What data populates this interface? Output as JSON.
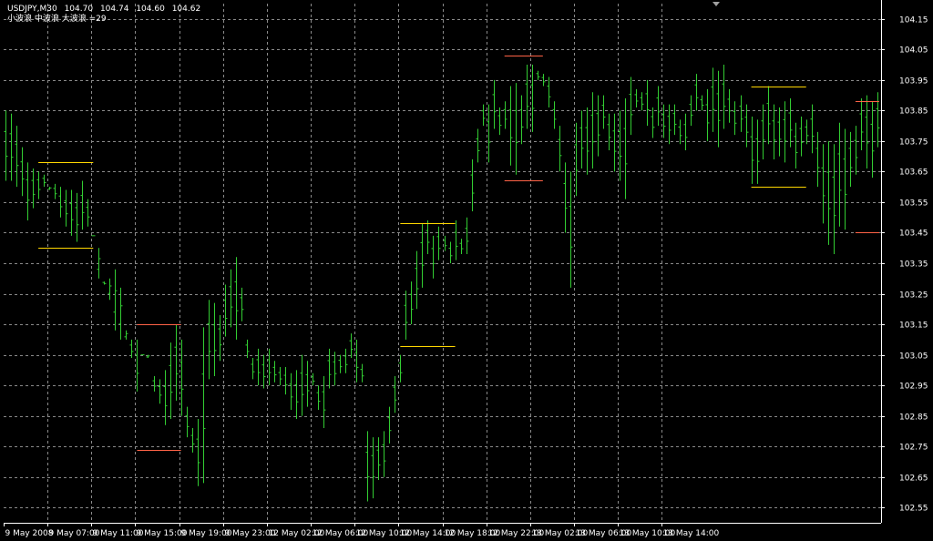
{
  "header": {
    "symbol": "USDJPY,M30",
    "open": "104.70",
    "high": "104.74",
    "low": "104.60",
    "close": "104.62",
    "indicator_label": "小波浪 中波浪 大波浪 =29"
  },
  "colors": {
    "background": "#000000",
    "grid": "#8a8a8a",
    "axis": "#ffffff",
    "bars": "#32cd32",
    "upper_level_a": "#ffd700",
    "upper_level_b": "#ff6347",
    "text": "#ffffff"
  },
  "chart_data": {
    "type": "ohlc",
    "title": "USDJPY,M30",
    "ylim": [
      102.5,
      104.2
    ],
    "y_ticks": [
      "104.15",
      "104.05",
      "103.95",
      "103.85",
      "103.75",
      "103.65",
      "103.55",
      "103.45",
      "103.35",
      "103.25",
      "103.15",
      "103.05",
      "102.95",
      "102.85",
      "102.75",
      "102.65",
      "102.55"
    ],
    "x_ticks": [
      "9 May 2008",
      "9 May 07:00",
      "9 May 11:00",
      "9 May 15:00",
      "9 May 19:00",
      "9 May 23:00",
      "12 May 02:00",
      "12 May 06:00",
      "12 May 10:00",
      "12 May 14:00",
      "12 May 18:00",
      "12 May 22:00",
      "13 May 02:00",
      "13 May 06:00",
      "13 May 10:00",
      "13 May 14:00"
    ],
    "grid": true,
    "bars_per_label": 8,
    "bar_count": 160,
    "lows": [
      103.62,
      103.62,
      103.6,
      103.57,
      103.49,
      103.53,
      103.56,
      103.6,
      103.6,
      103.56,
      103.5,
      103.47,
      103.44,
      103.42,
      103.46,
      103.47,
      103.44,
      103.4,
      103.28,
      103.3,
      103.33,
      103.27,
      103.13,
      103.04,
      102.93,
      103.05,
      103.05,
      102.93,
      102.89,
      102.82,
      102.84,
      102.9,
      102.85,
      102.78,
      102.73,
      102.62,
      102.63,
      102.97,
      102.98,
      103.03,
      103.11,
      103.14,
      103.1,
      103.16,
      103.04,
      102.97,
      102.95,
      102.94,
      102.95,
      102.96,
      102.95,
      102.92,
      102.87,
      102.84,
      102.85,
      102.88,
      102.95,
      102.87,
      102.81,
      102.94,
      102.95,
      102.99,
      102.99,
      103.04,
      102.96,
      102.96,
      102.57,
      102.58,
      102.64,
      102.65,
      102.76,
      102.86,
      102.96,
      103.1,
      103.15,
      103.2,
      103.27,
      103.38,
      103.3,
      103.36,
      103.39,
      103.35,
      103.36,
      103.38,
      103.38,
      103.52,
      103.68,
      103.8,
      103.68,
      103.79,
      103.77,
      103.79,
      103.67,
      103.64,
      103.74,
      103.79,
      103.78,
      103.95,
      103.93,
      103.86,
      103.79,
      103.65,
      103.45,
      103.27,
      103.57,
      103.66,
      103.64,
      103.66,
      103.7,
      103.79,
      103.72,
      103.65,
      103.62,
      103.56,
      103.77,
      103.86,
      103.85,
      103.8,
      103.76,
      103.8,
      103.76,
      103.74,
      103.77,
      103.74,
      103.72,
      103.8,
      103.85,
      103.85,
      103.75,
      103.78,
      103.73,
      103.79,
      103.81,
      103.77,
      103.78,
      103.73,
      103.61,
      103.61,
      103.69,
      103.74,
      103.69,
      103.7,
      103.68,
      103.73,
      103.66,
      103.7,
      103.74,
      103.71,
      103.6,
      103.48,
      103.41,
      103.38,
      103.47,
      103.46,
      103.6,
      103.64,
      103.72,
      103.66,
      103.63,
      103.73
    ],
    "highs": [
      103.85,
      103.84,
      103.8,
      103.73,
      103.68,
      103.66,
      103.65,
      103.64,
      103.59,
      103.61,
      103.6,
      103.59,
      103.59,
      103.58,
      103.62,
      103.56,
      103.44,
      103.3,
      103.29,
      103.23,
      103.13,
      103.1,
      103.1,
      103.1,
      103.1,
      103.05,
      103.04,
      102.98,
      102.97,
      103.0,
      103.09,
      103.15,
      103.1,
      102.88,
      102.81,
      102.84,
      103.14,
      103.23,
      103.22,
      103.18,
      103.28,
      103.33,
      103.37,
      103.27,
      103.1,
      103.04,
      103.07,
      103.05,
      103.07,
      103.03,
      103.01,
      103.01,
      102.99,
      103.0,
      103.05,
      103.03,
      102.99,
      102.95,
      102.98,
      103.07,
      103.06,
      103.05,
      103.07,
      103.12,
      103.1,
      103.02,
      102.8,
      102.78,
      102.78,
      102.8,
      102.88,
      102.98,
      103.05,
      103.26,
      103.29,
      103.39,
      103.48,
      103.49,
      103.44,
      103.47,
      103.44,
      103.42,
      103.49,
      103.43,
      103.5,
      103.69,
      103.79,
      103.87,
      103.87,
      103.95,
      103.86,
      103.88,
      103.93,
      103.94,
      103.9,
      104.0,
      104.0,
      103.98,
      103.97,
      103.96,
      103.88,
      103.8,
      103.68,
      103.65,
      103.81,
      103.85,
      103.86,
      103.91,
      103.9,
      103.9,
      103.84,
      103.84,
      103.85,
      103.89,
      103.96,
      103.92,
      103.91,
      103.95,
      103.86,
      103.93,
      103.87,
      103.87,
      103.87,
      103.82,
      103.84,
      103.9,
      103.97,
      103.9,
      103.92,
      103.99,
      103.98,
      104.0,
      103.92,
      103.88,
      103.9,
      103.87,
      103.83,
      103.82,
      103.87,
      103.93,
      103.87,
      103.86,
      103.88,
      103.89,
      103.81,
      103.83,
      103.82,
      103.87,
      103.78,
      103.74,
      103.75,
      103.74,
      103.81,
      103.79,
      103.78,
      103.8,
      103.89,
      103.9,
      103.88,
      103.91
    ],
    "levels": [
      {
        "start": 6,
        "end": 16,
        "price": 103.68,
        "color_key": "upper_level_a"
      },
      {
        "start": 6,
        "end": 16,
        "price": 103.4,
        "color_key": "upper_level_a"
      },
      {
        "start": 24,
        "end": 32,
        "price": 103.15,
        "color_key": "upper_level_b"
      },
      {
        "start": 24,
        "end": 32,
        "price": 102.74,
        "color_key": "upper_level_b"
      },
      {
        "start": 72,
        "end": 82,
        "price": 103.48,
        "color_key": "upper_level_a"
      },
      {
        "start": 72,
        "end": 82,
        "price": 103.08,
        "color_key": "upper_level_a"
      },
      {
        "start": 91,
        "end": 98,
        "price": 104.03,
        "color_key": "upper_level_b"
      },
      {
        "start": 91,
        "end": 98,
        "price": 103.62,
        "color_key": "upper_level_b"
      },
      {
        "start": 136,
        "end": 146,
        "price": 103.93,
        "color_key": "upper_level_a"
      },
      {
        "start": 136,
        "end": 146,
        "price": 103.6,
        "color_key": "upper_level_a"
      },
      {
        "start": 155,
        "end": 161,
        "price": 103.88,
        "color_key": "upper_level_b"
      },
      {
        "start": 155,
        "end": 161,
        "price": 103.45,
        "color_key": "upper_level_b"
      }
    ]
  }
}
